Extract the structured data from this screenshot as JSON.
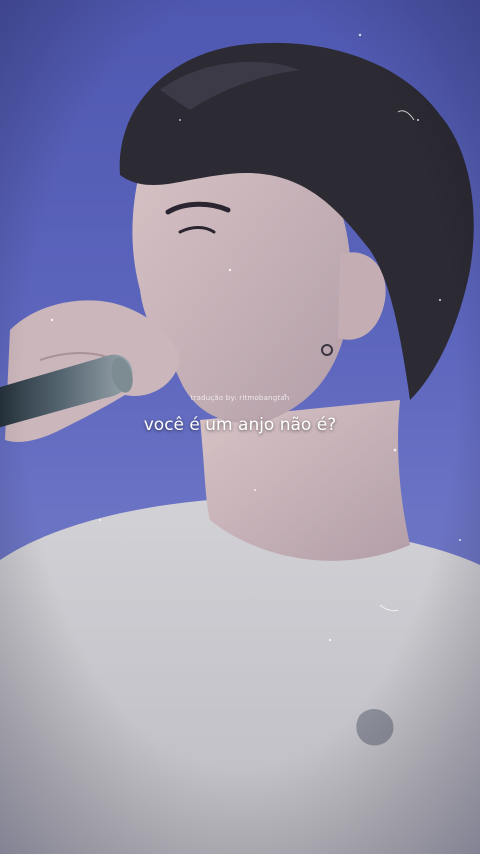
{
  "video": {
    "credit_text": "tradução by: ritmobangtan",
    "subtitle_text": "você é um anjo não é?"
  },
  "colors": {
    "background_sky": "#5b63b8",
    "hair": "#2c2a33",
    "skin": "#c9b3b8",
    "shirt": "#c9c8ce",
    "subtitle_text": "#ffffff"
  }
}
